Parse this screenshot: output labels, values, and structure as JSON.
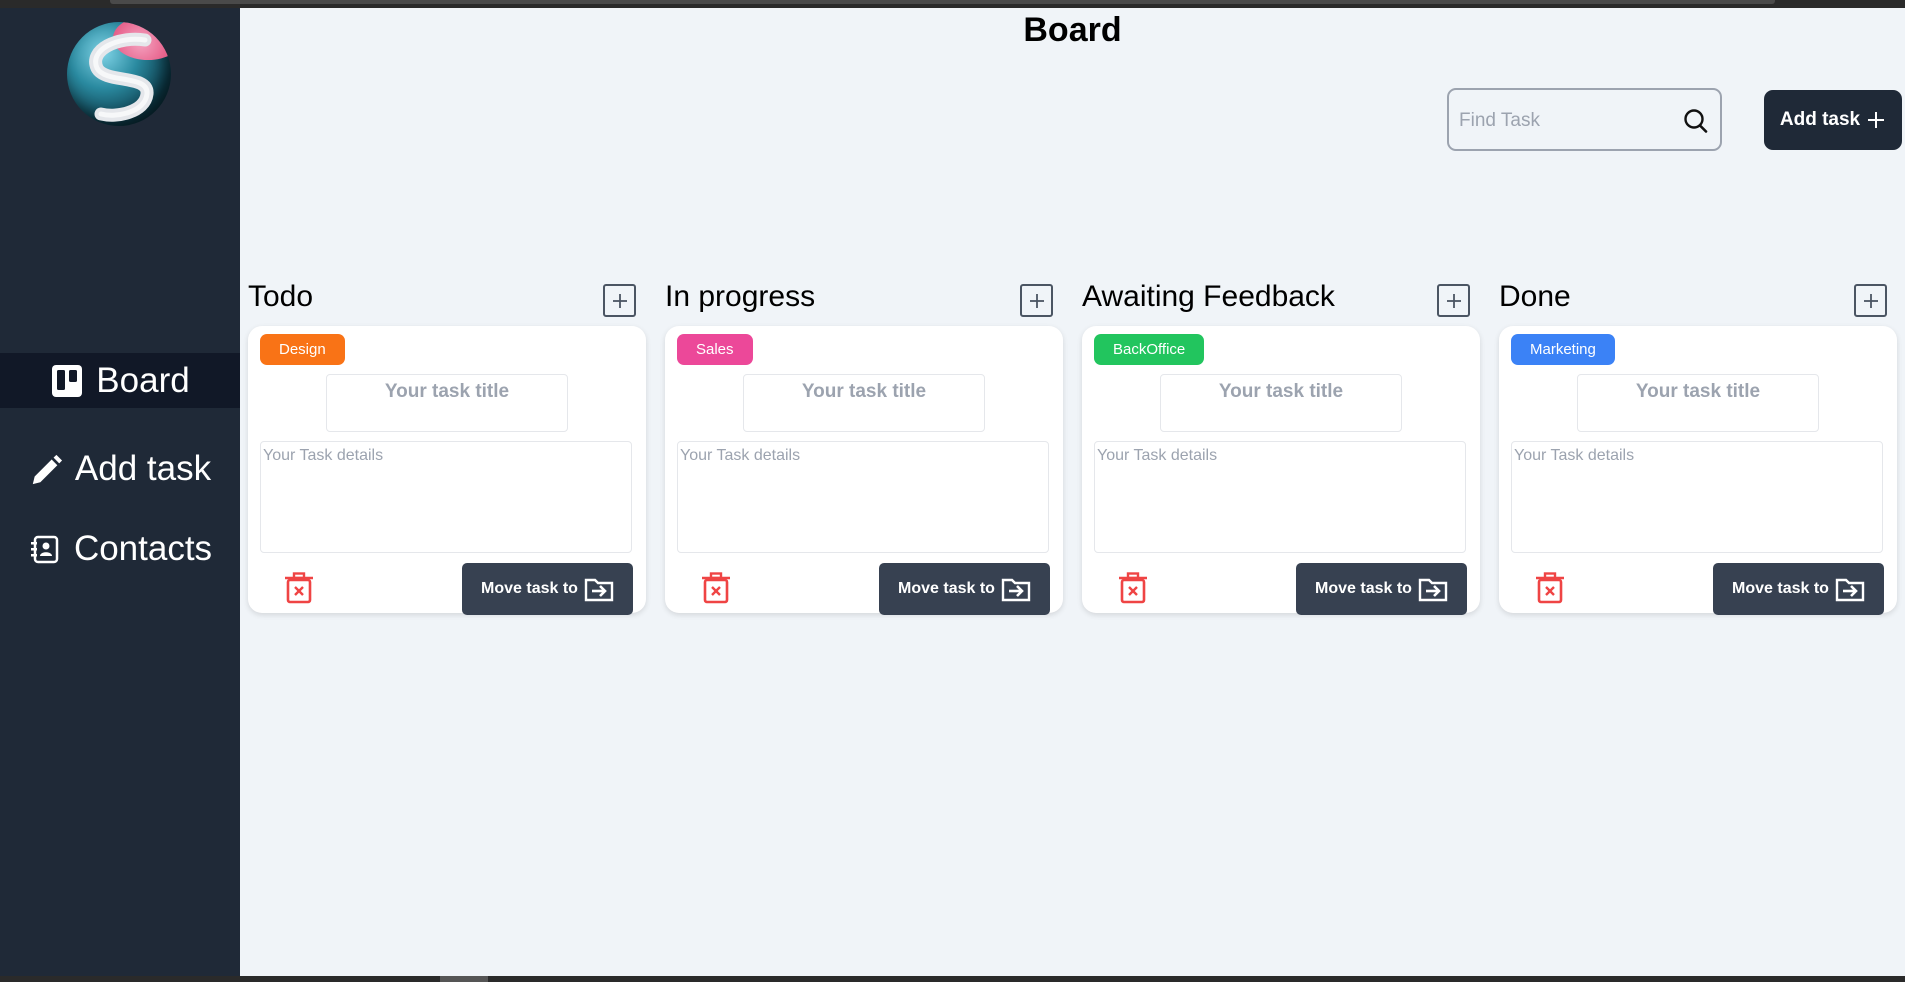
{
  "page": {
    "title": "Board"
  },
  "nav": [
    {
      "label": "Board",
      "icon": "board-icon",
      "active": true
    },
    {
      "label": "Add task",
      "icon": "pencil-icon",
      "active": false
    },
    {
      "label": "Contacts",
      "icon": "contacts-icon",
      "active": false
    }
  ],
  "search": {
    "placeholder": "Find Task",
    "value": ""
  },
  "header": {
    "add_task_label": "Add task"
  },
  "colors": {
    "sidebar": "#1f2937",
    "main_bg": "#f0f4f8",
    "button_dark": "#1f2937",
    "move_button": "#374151",
    "trash": "#ef4444"
  },
  "columns": [
    {
      "title": "Todo",
      "card": {
        "tag": "Design",
        "tag_color": "#f97316",
        "title_placeholder": "Your task title",
        "details_placeholder": "Your Task details",
        "move_label": "Move task to"
      }
    },
    {
      "title": "In progress",
      "card": {
        "tag": "Sales",
        "tag_color": "#ec4899",
        "title_placeholder": "Your task title",
        "details_placeholder": "Your Task details",
        "move_label": "Move task to"
      }
    },
    {
      "title": "Awaiting Feedback",
      "card": {
        "tag": "BackOffice",
        "tag_color": "#22c55e",
        "title_placeholder": "Your task title",
        "details_placeholder": "Your Task details",
        "move_label": "Move task to"
      }
    },
    {
      "title": "Done",
      "card": {
        "tag": "Marketing",
        "tag_color": "#3b82f6",
        "title_placeholder": "Your task title",
        "details_placeholder": "Your Task details",
        "move_label": "Move task to"
      }
    }
  ]
}
